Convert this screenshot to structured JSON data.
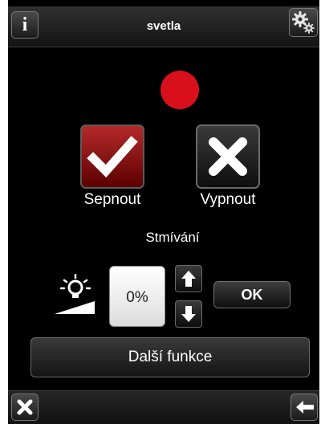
{
  "header": {
    "title": "svetla",
    "info_icon": "info-icon",
    "settings_icon": "gears-icon"
  },
  "status": {
    "indicator_color": "#d9101c"
  },
  "buttons": {
    "on_label": "Sepnout",
    "off_label": "Vypnout"
  },
  "dimming": {
    "label": "Stmívání",
    "value": "0%",
    "ok_label": "OK"
  },
  "more": {
    "label": "Další funkce"
  },
  "footer": {
    "close_icon": "close-icon",
    "back_icon": "back-arrow-icon"
  }
}
